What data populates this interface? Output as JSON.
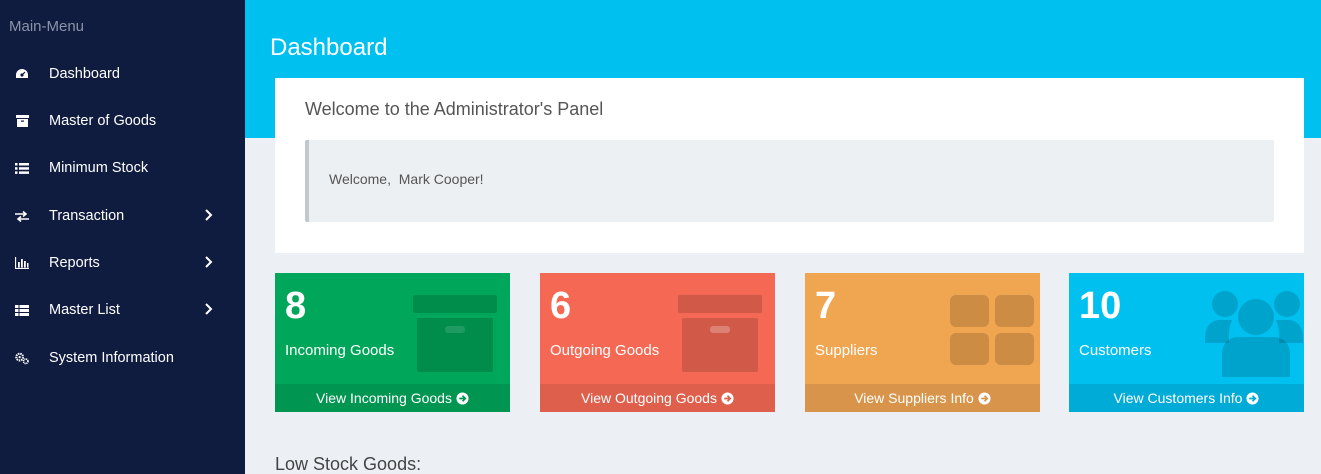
{
  "sidebar": {
    "header": "Main-Menu",
    "items": [
      {
        "label": "Dashboard",
        "icon": "dashboard-icon"
      },
      {
        "label": "Master of Goods",
        "icon": "archive-icon"
      },
      {
        "label": "Minimum Stock",
        "icon": "list-icon"
      },
      {
        "label": "Transaction",
        "icon": "exchange-icon"
      },
      {
        "label": "Reports",
        "icon": "bar-chart-icon"
      },
      {
        "label": "Master List",
        "icon": "th-list-icon"
      },
      {
        "label": "System Information",
        "icon": "gears-icon"
      }
    ]
  },
  "header": {
    "title": "Dashboard"
  },
  "welcome": {
    "title": "Welcome to the Administrator's Panel",
    "message": "Welcome,  Mark Cooper!"
  },
  "stats": [
    {
      "value": "8",
      "label": "Incoming Goods",
      "link": "View Incoming Goods",
      "color": "#00a65a"
    },
    {
      "value": "6",
      "label": "Outgoing Goods",
      "link": "View Outgoing Goods",
      "color": "#f56954"
    },
    {
      "value": "7",
      "label": "Suppliers",
      "link": "View Suppliers Info",
      "color": "#f0a551"
    },
    {
      "value": "10",
      "label": "Customers",
      "link": "View Customers Info",
      "color": "#00c0ef"
    }
  ],
  "low_stock": {
    "title": "Low Stock Goods:"
  },
  "colors": {
    "sidebar": "#0f1b3f",
    "header": "#00c0ef",
    "background": "#ecf0f5"
  }
}
